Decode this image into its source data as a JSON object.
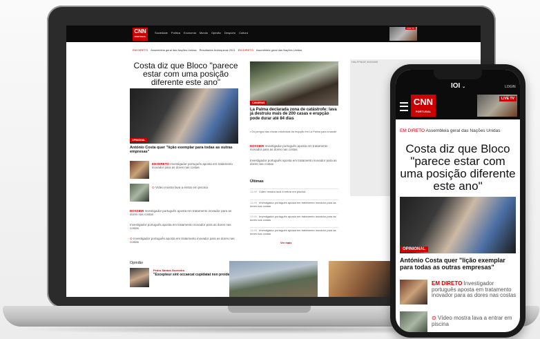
{
  "desktop": {
    "nav": {
      "logo": "CNN",
      "logo_sub": "PORTUGAL",
      "links": [
        "Sociedade",
        "Política",
        "Economia",
        "Mundo",
        "Opinião",
        "Desporto",
        "Cultura"
      ],
      "live_label": "LIVE TV"
    },
    "ticker": {
      "item1_tag": "EM DIRETO",
      "item1_text": "Assembleia geral das Nações Unidas",
      "item2_text": "Resultados Autárquicas 2021",
      "item3_tag": "EM DIRETO",
      "item3_text": "Assembleia geral das Nações Unidas"
    },
    "lead": {
      "title": "Costa diz que Bloco \"parece estar com uma posição diferente este ano\"",
      "tag": "OPINIONAL",
      "caption": "António Costa quer \"lição exemplar para todas as outras empresas\""
    },
    "snippets": [
      {
        "tag": "EM DIRETO",
        "text": "Investigador português aposta em tratamento inovador para as dores nas costas"
      },
      {
        "tag": "",
        "text": "Vídeo mostra lava a entrar em piscina"
      },
      {
        "tag": "DOSSIER",
        "text": "Investigador português aposta em tratamento inovador para as dores nas costas"
      },
      {
        "tag": "",
        "text": "Investigador português aposta em tratamento inovador para as dores nas costas"
      },
      {
        "tag": "",
        "text": "Investigador português aposta em tratamento inovador para as dores nas costas"
      }
    ],
    "middle": {
      "tag": "CANÁRIAS",
      "title": "La Palma declarada zona de catástrofe: lava já destruiu mais de 200 casas e erupção pode durar até 84 dias",
      "sub": "Os perigos das cinzas vulcânicas da erupção em La Palma para a saúde",
      "dossier_tag": "DOSSIER",
      "dossier_text": "Investigador português aposta em tratamento inovador para as dores nas costas",
      "extra_text": "Investigador português aposta em tratamento inovador para as dores nas costas"
    },
    "ultimas": {
      "heading": "Últimas",
      "items": [
        {
          "time": "13:49",
          "text": "Vídeo mostra lava a entrar em piscina"
        },
        {
          "time": "13:49",
          "text": "Investigador português aposta em tratamento inovador para as dores nas costas"
        },
        {
          "time": "13:49",
          "text": "Investigador português aposta em tratamento inovador para as dores nas costas"
        },
        {
          "time": "13:49",
          "text": "Investigador português aposta em tratamento inovador para as dores nas costas"
        }
      ],
      "more": "Ver mais"
    },
    "ad": {
      "label": "HALFPAGE 300X600"
    },
    "opiniao": {
      "heading": "Opinião",
      "author": "Pedro Santos Guerreiro",
      "quote": "\"Excepteur sint occaecat cupidatat non proident\""
    }
  },
  "mobile": {
    "brand": "IOI",
    "login": "LOGIN",
    "logo": "CNN",
    "logo_sub": "PORTUGAL",
    "live_label": "LIVE TV",
    "ticker_tag": "EM DIRETO",
    "ticker_text": "Assembleia geral das Nações Unidas",
    "title": "Costa diz que Bloco \"parece estar com uma posição diferente este ano\"",
    "tag": "OPINIONAL",
    "caption": "António Costa quer \"lição exemplar para todas as outras empresas\"",
    "snippet1_tag": "EM DIRETO",
    "snippet1_text": "Investigador português aposta em tratamento inovador para as dores nas costas",
    "snippet2_text": "Vídeo mostra lava a entrar em piscina"
  },
  "colors": {
    "brand_red": "#cc0000",
    "header_black": "#0c0c0c"
  }
}
